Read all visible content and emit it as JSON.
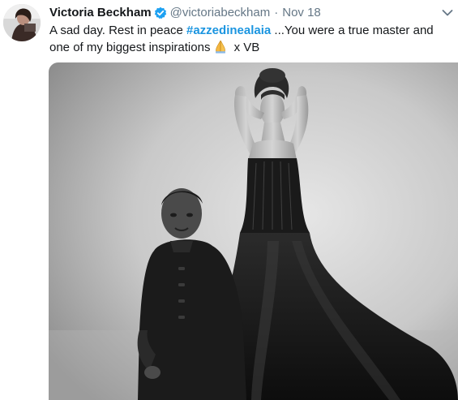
{
  "tweet": {
    "author": {
      "display_name": "Victoria Beckham",
      "handle": "@victoriabeckham",
      "verified": true,
      "avatar_icon": "user-avatar"
    },
    "separator": "·",
    "timestamp": "Nov 18",
    "text": {
      "part1": "A sad day. Rest in peace ",
      "hashtag": "#azzedinealaia",
      "part2": " ...You were a true master and one of my biggest inspirations",
      "emoji": "folded-hands",
      "part3": " x VB"
    },
    "menu_icon": "chevron-down-icon",
    "media": {
      "type": "black-and-white photo",
      "alt": "Man in dark jacket standing beside a model in a black corset gown"
    }
  },
  "colors": {
    "text": "#14171a",
    "secondary": "#657786",
    "link": "#1b95e0",
    "verified": "#1da1f2"
  }
}
